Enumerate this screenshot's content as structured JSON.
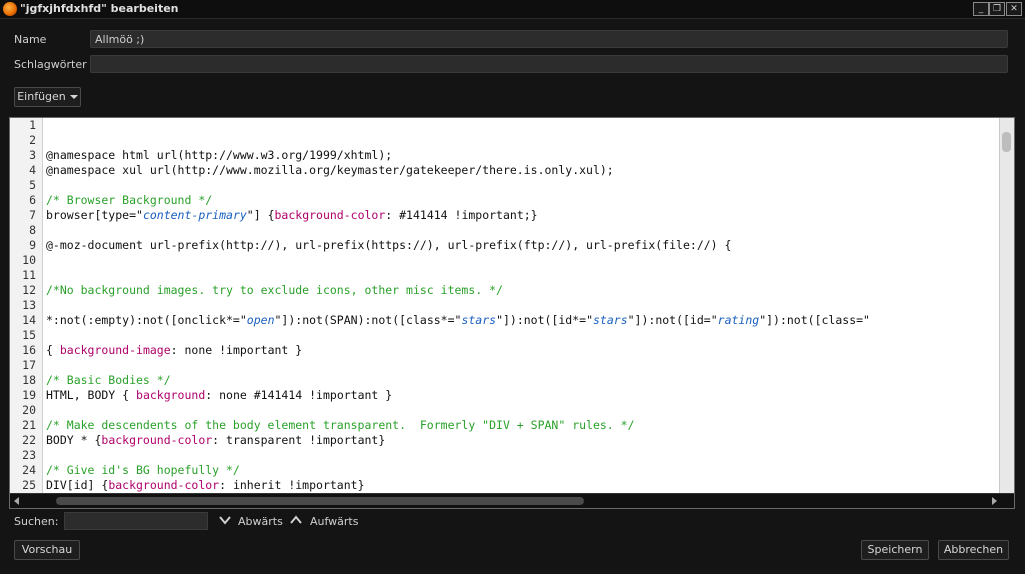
{
  "window": {
    "title": "\"jgfxjhfdxhfd\" bearbeiten",
    "controls": {
      "minimize": "_",
      "restore": "❐",
      "close": "✕"
    }
  },
  "form": {
    "name_label": "Name",
    "name_value": "Allmöö ;)",
    "tags_label": "Schlagwörter",
    "tags_value": ""
  },
  "toolbar": {
    "insert_label": "Einfügen"
  },
  "editor": {
    "lines": [
      {
        "n": "1",
        "t": ""
      },
      {
        "n": "2",
        "t": ""
      },
      {
        "n": "3",
        "t": "@namespace html url(http://www.w3.org/1999/xhtml);"
      },
      {
        "n": "4",
        "t": "@namespace xul url(http://www.mozilla.org/keymaster/gatekeeper/there.is.only.xul);"
      },
      {
        "n": "5",
        "t": ""
      },
      {
        "n": "6",
        "t": "/* Browser Background */"
      },
      {
        "n": "7",
        "t": "browser[type=\"content-primary\"] {background-color: #141414 !important;}"
      },
      {
        "n": "8",
        "t": ""
      },
      {
        "n": "9",
        "t": "@-moz-document url-prefix(http://), url-prefix(https://), url-prefix(ftp://), url-prefix(file://) {"
      },
      {
        "n": "10",
        "t": ""
      },
      {
        "n": "11",
        "t": ""
      },
      {
        "n": "12",
        "t": "/*No background images. try to exclude icons, other misc items. */"
      },
      {
        "n": "13",
        "t": ""
      },
      {
        "n": "14",
        "t": "*:not(:empty):not([onclick*=\"open\"]):not(SPAN):not([class*=\"stars\"]):not([id*=\"stars\"]):not([id=\"rating\"]):not([class=\""
      },
      {
        "n": "15",
        "t": ""
      },
      {
        "n": "16",
        "t": "{ background-image: none !important }"
      },
      {
        "n": "17",
        "t": ""
      },
      {
        "n": "18",
        "t": "/* Basic Bodies */"
      },
      {
        "n": "19",
        "t": "HTML, BODY { background: none #141414 !important }"
      },
      {
        "n": "20",
        "t": ""
      },
      {
        "n": "21",
        "t": "/* Make descendents of the body element transparent.  Formerly \"DIV + SPAN\" rules. */"
      },
      {
        "n": "22",
        "t": "BODY * {background-color: transparent !important}"
      },
      {
        "n": "23",
        "t": ""
      },
      {
        "n": "24",
        "t": "/* Give id's BG hopefully */"
      },
      {
        "n": "25",
        "t": "DIV[id] {background-color: inherit !important}"
      }
    ]
  },
  "search": {
    "label": "Suchen:",
    "value": "",
    "down_label": "Abwärts",
    "up_label": "Aufwärts"
  },
  "footer": {
    "preview_label": "Vorschau",
    "save_label": "Speichern",
    "cancel_label": "Abbrechen"
  }
}
